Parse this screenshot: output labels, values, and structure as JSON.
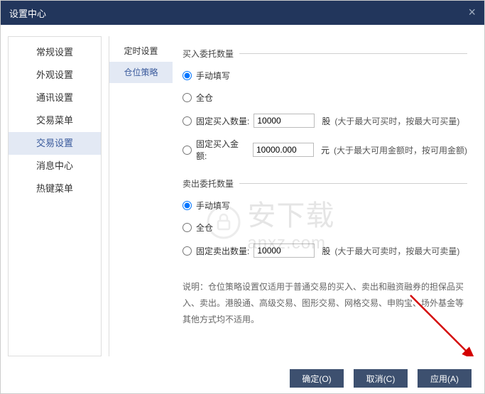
{
  "window": {
    "title": "设置中心"
  },
  "leftNav": {
    "items": [
      {
        "label": "常规设置"
      },
      {
        "label": "外观设置"
      },
      {
        "label": "通讯设置"
      },
      {
        "label": "交易菜单"
      },
      {
        "label": "交易设置"
      },
      {
        "label": "消息中心"
      },
      {
        "label": "热键菜单"
      }
    ]
  },
  "subNav": {
    "items": [
      {
        "label": "定时设置"
      },
      {
        "label": "仓位策略"
      }
    ]
  },
  "buy": {
    "title": "买入委托数量",
    "manual": "手动填写",
    "full": "全仓",
    "fixedQtyLabel": "固定买入数量:",
    "fixedQtyValue": "10000",
    "fixedQtyUnit": "股",
    "fixedQtyHint": "(大于最大可买时，按最大可买量)",
    "fixedAmtLabel": "固定买入金额:",
    "fixedAmtValue": "10000.000",
    "fixedAmtUnit": "元",
    "fixedAmtHint": "(大于最大可用金额时，按可用金额)"
  },
  "sell": {
    "title": "卖出委托数量",
    "manual": "手动填写",
    "full": "全仓",
    "fixedQtyLabel": "固定卖出数量:",
    "fixedQtyValue": "10000",
    "fixedQtyUnit": "股",
    "fixedQtyHint": "(大于最大可卖时，按最大可卖量)"
  },
  "notes": "说明：仓位策略设置仅适用于普通交易的买入、卖出和融资融券的担保品买入、卖出。港股通、高级交易、图形交易、网格交易、申购宝、场外基金等其他方式均不适用。",
  "footer": {
    "ok": "确定(O)",
    "cancel": "取消(C)",
    "apply": "应用(A)"
  },
  "watermark": {
    "main": "安下载",
    "sub": "anxz.com"
  }
}
